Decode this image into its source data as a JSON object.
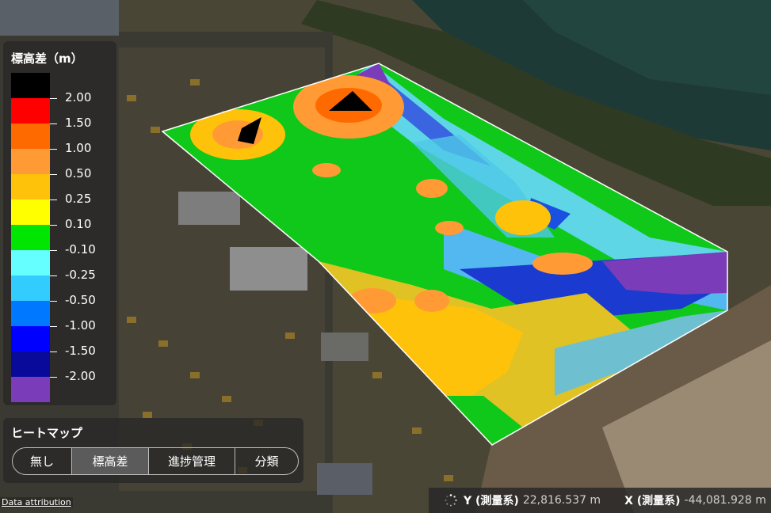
{
  "legend": {
    "title": "標高差（m）",
    "colors": [
      "#000000",
      "#ff0000",
      "#ff6a00",
      "#ff9a35",
      "#ffc20a",
      "#ffff00",
      "#00e600",
      "#66ffff",
      "#33ccff",
      "#0078ff",
      "#0000ff",
      "#0a0a9a",
      "#7a3cb8"
    ],
    "ticks": [
      "2.00",
      "1.50",
      "1.00",
      "0.50",
      "0.25",
      "0.10",
      "-0.10",
      "-0.25",
      "-0.50",
      "-1.00",
      "-1.50",
      "-2.00"
    ]
  },
  "heatmap": {
    "title": "ヒートマップ",
    "options": [
      {
        "label": "無し",
        "active": false
      },
      {
        "label": "標高差",
        "active": true
      },
      {
        "label": "進捗管理",
        "active": false
      },
      {
        "label": "分類",
        "active": false
      }
    ]
  },
  "attribution": "Data attribution",
  "status": {
    "y_label": "Y (測量系)",
    "y_value": "22,816.537 m",
    "x_label": "X (測量系)",
    "x_value": "-44,081.928 m"
  }
}
